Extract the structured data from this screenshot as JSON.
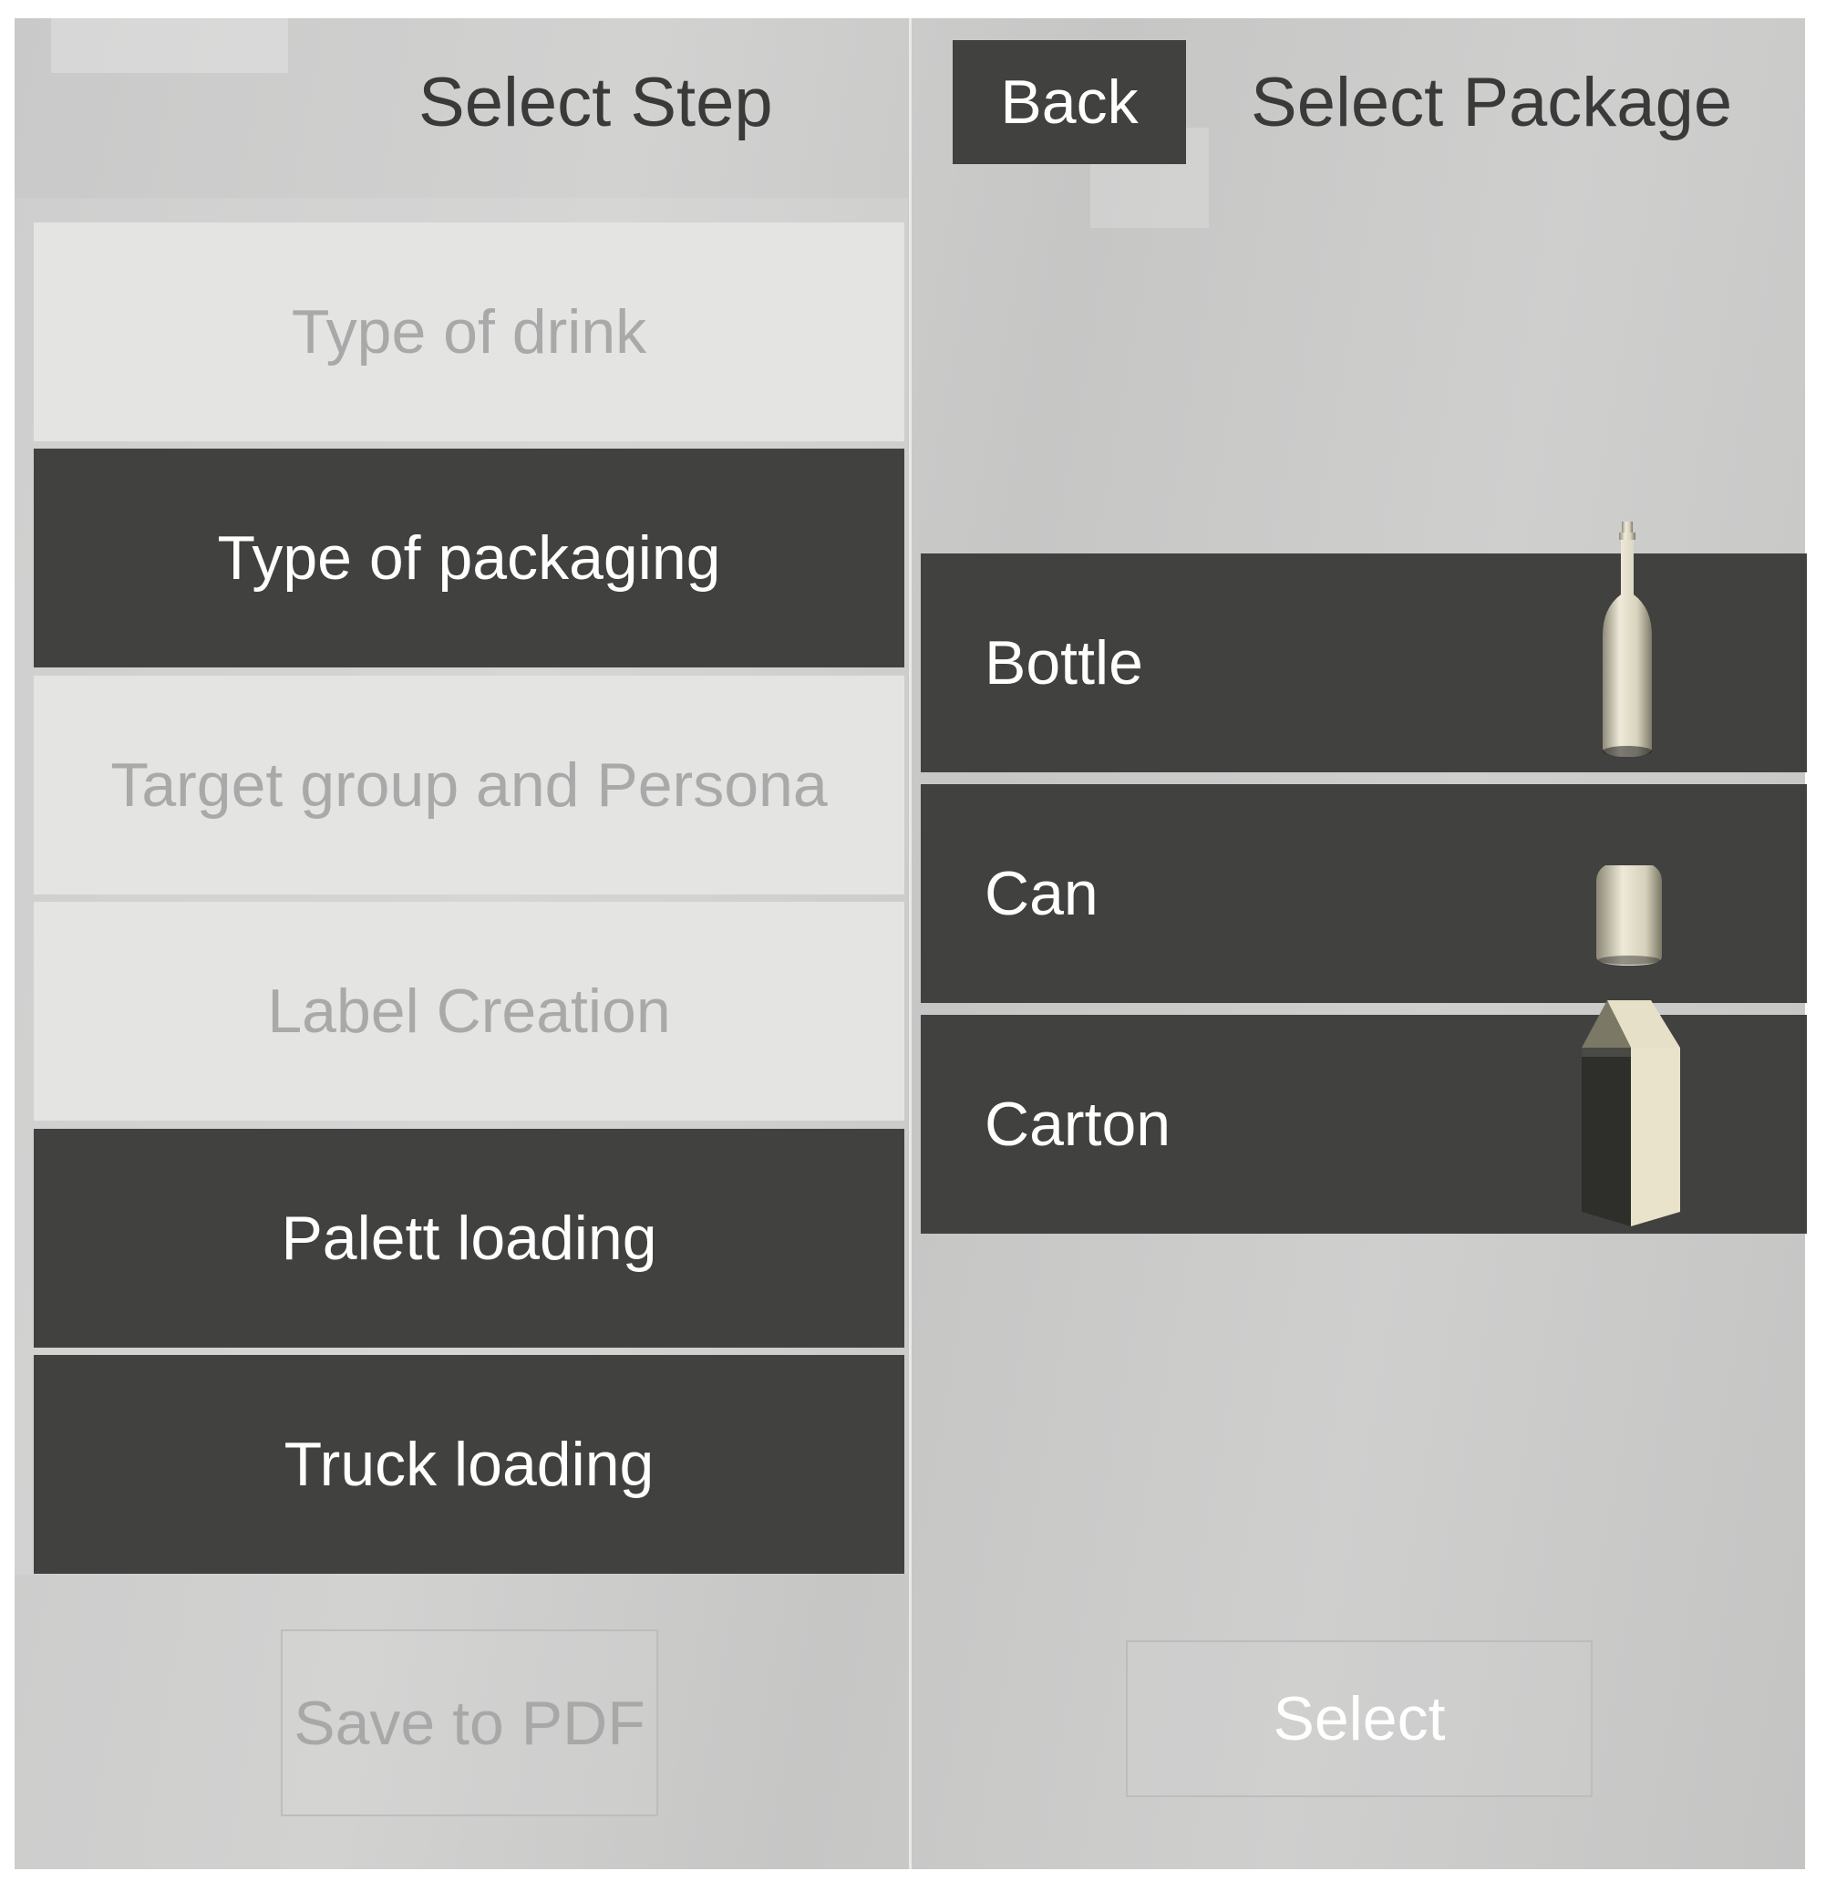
{
  "steps_panel": {
    "title": "Select Step",
    "items": [
      {
        "label": "Type of drink",
        "state": "disabled"
      },
      {
        "label": "Type of packaging",
        "state": "active"
      },
      {
        "label": "Target group and Persona",
        "state": "disabled"
      },
      {
        "label": "Label Creation",
        "state": "disabled"
      },
      {
        "label": "Palett loading",
        "state": "active"
      },
      {
        "label": "Truck loading",
        "state": "active"
      }
    ],
    "save_button_label": "Save to PDF"
  },
  "package_panel": {
    "back_button_label": "Back",
    "title": "Select Package",
    "items": [
      {
        "label": "Bottle",
        "icon": "bottle-icon"
      },
      {
        "label": "Can",
        "icon": "can-icon"
      },
      {
        "label": "Carton",
        "icon": "carton-icon"
      }
    ],
    "select_button_label": "Select"
  },
  "colors": {
    "item_dark": "#414140",
    "item_light": "#e4e4e3",
    "text_light": "#ffffff",
    "text_disabled": "#a9a9a9",
    "panel_bg": "#cbcbca",
    "object_cream": "#e9e4cc"
  }
}
